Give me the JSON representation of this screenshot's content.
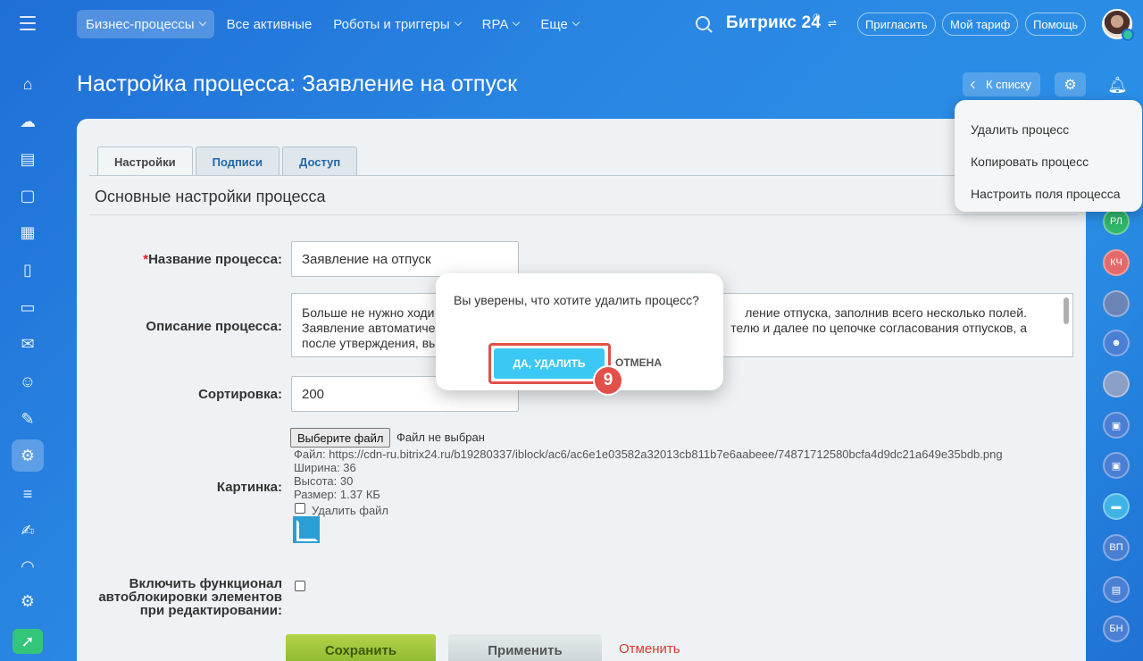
{
  "topbar": {
    "nav": [
      {
        "label": "Бизнес-процессы",
        "has_chevron": true,
        "active": true
      },
      {
        "label": "Все активные",
        "has_chevron": false
      },
      {
        "label": "Роботы и триггеры",
        "has_chevron": true
      },
      {
        "label": "RPA",
        "has_chevron": true
      },
      {
        "label": "Еще",
        "has_chevron": true
      }
    ],
    "brand": "Битрикс 24",
    "invite": "Пригласить",
    "tariff": "Мой тариф",
    "help": "Помощь"
  },
  "page": {
    "title": "Настройка процесса: Заявление на отпуск",
    "back_label": "К списку"
  },
  "menu": {
    "items": [
      "Удалить процесс",
      "Копировать процесс",
      "Настроить поля процесса"
    ]
  },
  "tabs": [
    "Настройки",
    "Подписи",
    "Доступ"
  ],
  "section_title": "Основные настройки процесса",
  "form": {
    "name_label": "Название процесса:",
    "name_value": "Заявление на отпуск",
    "desc_label": "Описание процесса:",
    "desc_line1_a": "Больше не нужно ходи",
    "desc_line1_b": "ление отпуска, заполнив всего несколько полей.",
    "desc_line2_a": "Заявление автоматиче",
    "desc_line2_b": "телю и далее по цепочке согласования отпусков, а",
    "desc_line3_a": "после утверждения, вы",
    "sort_label": "Сортировка:",
    "sort_value": "200",
    "image_label": "Картинка:",
    "file_button": "Выберите файл",
    "file_none": "Файл не выбран",
    "file_info": "Файл: https://cdn-ru.bitrix24.ru/b19280337/iblock/ac6/ac6e1e03582a32013cb811b7e6aabeee/74871712580bcfa4d9dc21a649e35bdb.png",
    "width": "Ширина: 36",
    "height": "Высота: 30",
    "size": "Размер: 1.37 КБ",
    "delete_file": "Удалить файл",
    "autolock_line1": "Включить функционал",
    "autolock_line2": "автоблокировки элементов",
    "autolock_line3": "при редактировании:"
  },
  "buttons": {
    "save": "Сохранить",
    "apply": "Применить",
    "cancel": "Отменить"
  },
  "dialog": {
    "question": "Вы уверены, что хотите удалить процесс?",
    "confirm": "ДА, УДАЛИТЬ",
    "cancel": "ОТМЕНА",
    "step": "9"
  },
  "right_sidebar": [
    "РЛ",
    "КЧ",
    "ВП",
    "БН"
  ],
  "colors": {
    "accent": "#3bc8f5",
    "highlight": "#e2504a",
    "save_green": "#9bc43a",
    "background": "#2a87e3"
  }
}
